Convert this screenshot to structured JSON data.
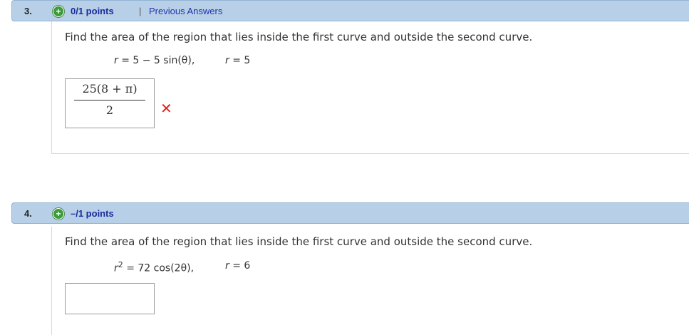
{
  "q3": {
    "number": "3.",
    "plus_icon": "+",
    "points": "0/1 points",
    "separator": "|",
    "prev_link": "Previous Answers",
    "prompt": "Find the area of the region that lies inside the first curve and outside the second curve.",
    "eq1_lhs": "r",
    "eq1_rhs": " = 5 − 5 sin(θ),",
    "eq2_lhs": "r",
    "eq2_rhs": " = 5",
    "answer_numerator": "25(8 + π)",
    "answer_denominator": "2",
    "result_icon": "✕",
    "result_color": "#e02020"
  },
  "q4": {
    "number": "4.",
    "plus_icon": "+",
    "points": "–/1 points",
    "prompt": "Find the area of the region that lies inside the first curve and outside the second curve.",
    "eq1_lhs": "r",
    "eq1_exp": "2",
    "eq1_rhs": " = 72 cos(2θ),",
    "eq2_lhs": "r",
    "eq2_rhs": " = 6",
    "answer_value": ""
  },
  "colors": {
    "header_bg": "#b7d0e8",
    "points_text": "#1a2a9a",
    "link": "#2233aa",
    "plus_green": "#3a9d3a"
  }
}
